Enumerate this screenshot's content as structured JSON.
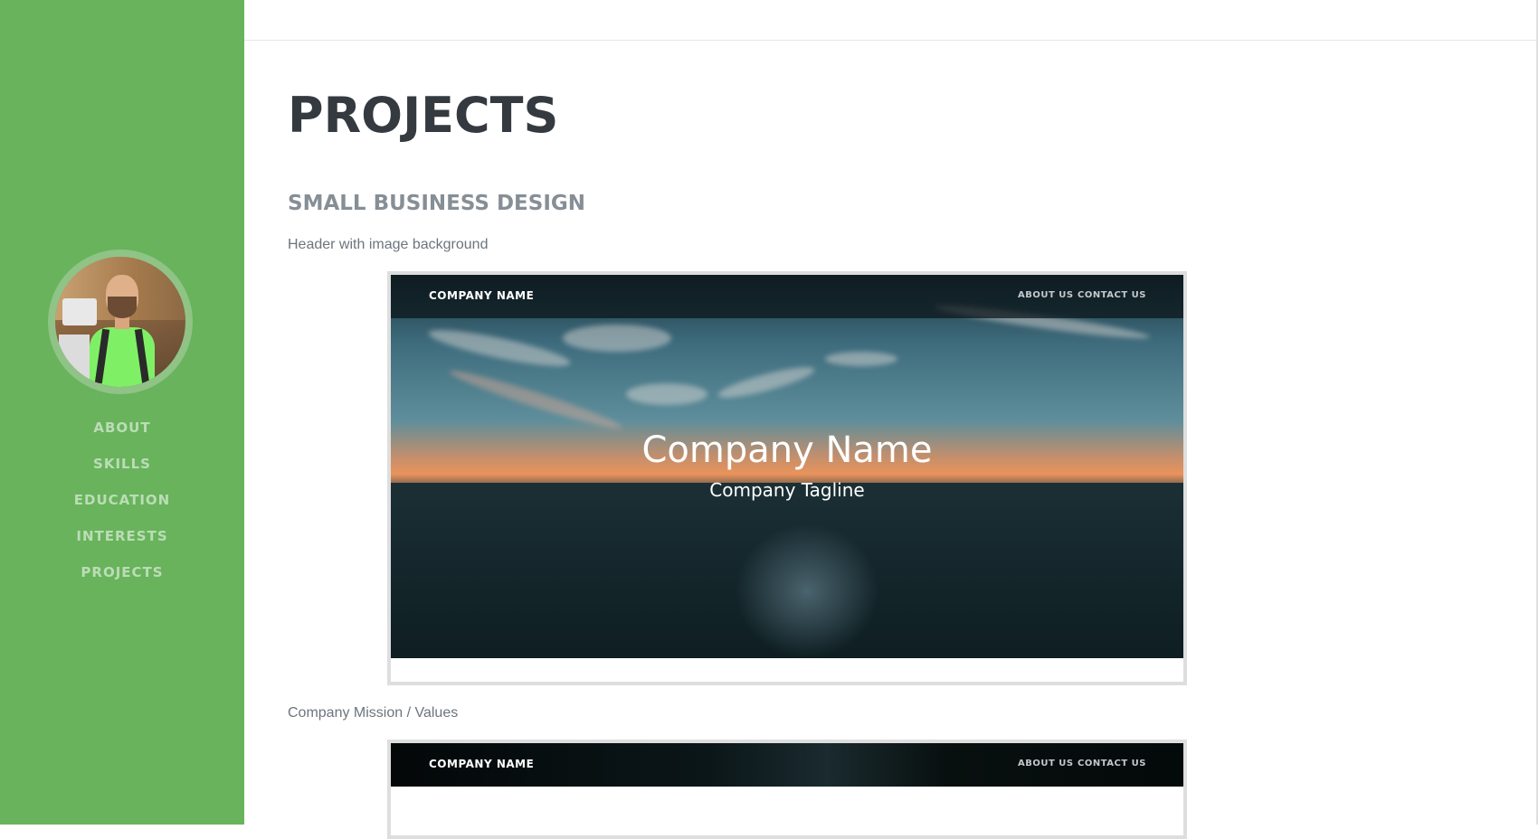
{
  "sidebar": {
    "background": "#68b35c",
    "avatar_alt": "profile photo",
    "items": [
      {
        "label": "ABOUT"
      },
      {
        "label": "SKILLS"
      },
      {
        "label": "EDUCATION"
      },
      {
        "label": "INTERESTS"
      },
      {
        "label": "PROJECTS"
      }
    ]
  },
  "main": {
    "page_title": "PROJECTS",
    "section_title": "SMALL BUSINESS DESIGN",
    "projects": [
      {
        "caption": "Header with image background",
        "preview": {
          "brand": "COMPANY NAME",
          "links": [
            "ABOUT US",
            "CONTACT US"
          ],
          "hero_title": "Company Name",
          "hero_tagline": "Company Tagline"
        }
      },
      {
        "caption": "Company Mission / Values",
        "preview": {
          "brand": "COMPANY NAME",
          "links": [
            "ABOUT US",
            "CONTACT US"
          ]
        }
      }
    ]
  },
  "colors": {
    "accent": "#68b35c",
    "title": "#343a40",
    "subtitle": "#868e96",
    "text": "#6c757d"
  }
}
